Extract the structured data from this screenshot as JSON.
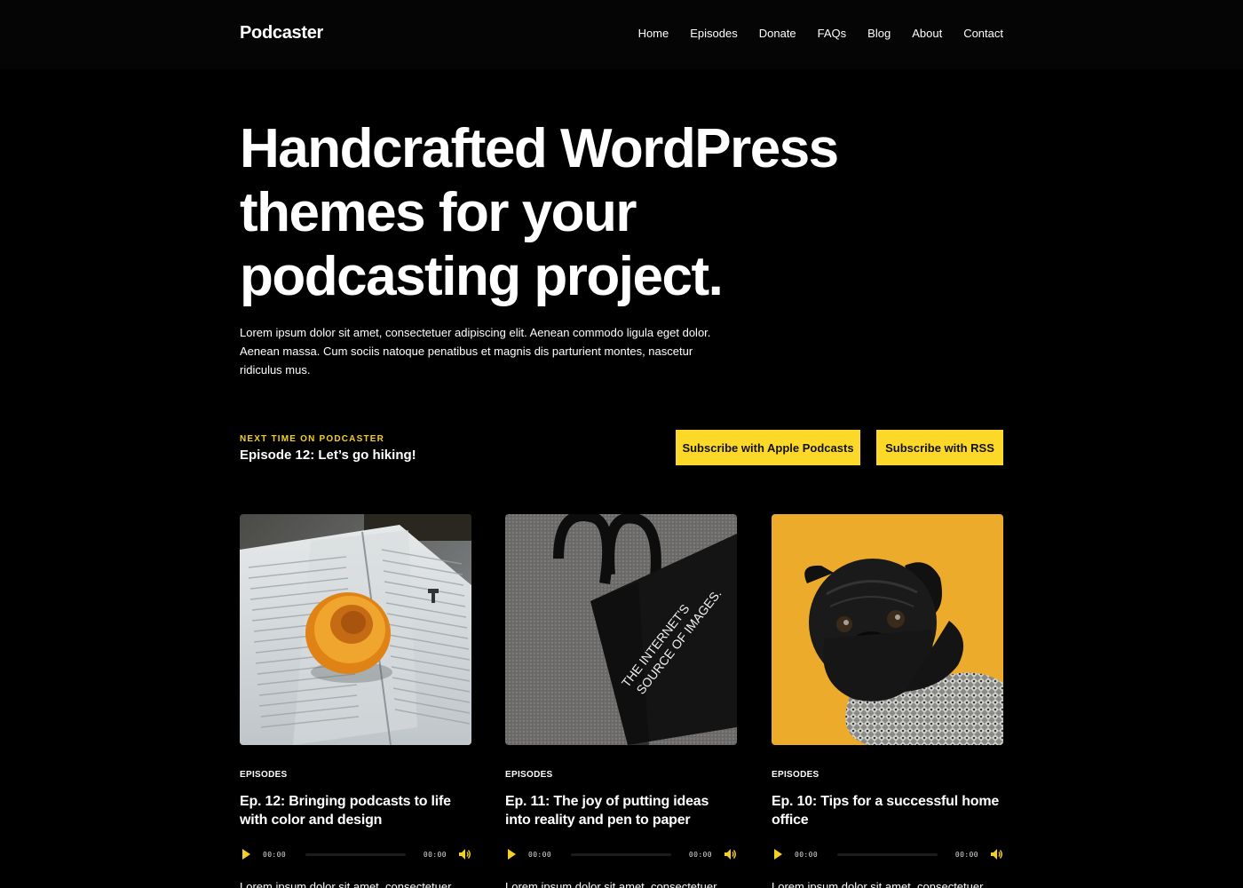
{
  "site": {
    "title": "Podcaster"
  },
  "nav": {
    "items": [
      "Home",
      "Episodes",
      "Donate",
      "FAQs",
      "Blog",
      "About",
      "Contact"
    ]
  },
  "hero": {
    "title": "Handcrafted WordPress themes for your podcasting project.",
    "description": "Lorem ipsum dolor sit amet, consectetuer adipiscing elit. Aenean commodo ligula eget dolor. Aenean massa. Cum sociis natoque penatibus et magnis dis parturient montes, nascetur ridiculus mus."
  },
  "next": {
    "label": "NEXT TIME ON PODCASTER",
    "title": "Episode 12: Let’s go hiking!"
  },
  "buttons": {
    "apple": "Subscribe with Apple Podcasts",
    "rss": "Subscribe with RSS"
  },
  "cards": [
    {
      "category": "EPISODES",
      "title": "Ep. 12: Bringing podcasts to life with color and design",
      "time_current": "00:00",
      "time_duration": "00:00",
      "excerpt": "Lorem ipsum dolor sit amet, consectetuer"
    },
    {
      "category": "EPISODES",
      "title": "Ep. 11: The joy of putting ideas into reality and pen to paper",
      "time_current": "00:00",
      "time_duration": "00:00",
      "excerpt": "Lorem ipsum dolor sit amet, consectetuer",
      "image_text": "THE INTERNET'S SOURCE OF IMAGES."
    },
    {
      "category": "EPISODES",
      "title": "Ep. 10: Tips for a successful home office",
      "time_current": "00:00",
      "time_duration": "00:00",
      "excerpt": "Lorem ipsum dolor sit amet, consectetuer"
    }
  ],
  "colors": {
    "accent": "#fcd928",
    "background": "#000000",
    "pug_background": "#ecab2b"
  },
  "icons": [
    "play-icon",
    "volume-icon"
  ]
}
